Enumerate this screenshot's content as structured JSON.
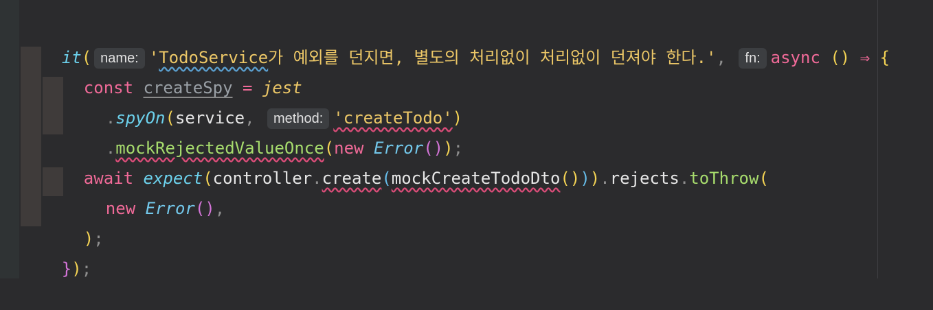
{
  "editor": {
    "language": "typescript",
    "line1": {
      "it": "it",
      "open_paren": "(",
      "hint_name": "name:",
      "quote_open": "'",
      "todoservice": "TodoService",
      "korean": "가 예외를 던지면, 별도의 처리없이 처리없이 던져야 한다.",
      "quote_close": "'",
      "comma": ",",
      "hint_fn": "fn:",
      "async": "async",
      "params": "()",
      "arrow": "⇒",
      "brace": "{"
    },
    "line2": {
      "const": "const",
      "var": "createSpy",
      "eq": "=",
      "jest": "jest"
    },
    "line3": {
      "dot": ".",
      "method": "spyOn",
      "open": "(",
      "arg": "service",
      "comma": ",",
      "hint_method": "method:",
      "str": "'createTodo'",
      "close": ")"
    },
    "line4": {
      "dot": ".",
      "method": "mockRejectedValueOnce",
      "open": "(",
      "new": "new",
      "cls": "Error",
      "parens": "()",
      "close": ")",
      "semi": ";"
    },
    "line5": {
      "await": "await",
      "expect": "expect",
      "open": "(",
      "controller": "controller",
      "dot1": ".",
      "create": "create",
      "open2": "(",
      "dto": "mockCreateTodoDto",
      "parens": "()",
      "close2": ")",
      "close1": ")",
      "dot2": ".",
      "rejects": "rejects",
      "dot3": ".",
      "tothrow": "toThrow",
      "open3": "("
    },
    "line6": {
      "new": "new",
      "cls": "Error",
      "parens": "()",
      "comma": ","
    },
    "line7": {
      "close": ")",
      "semi": ";"
    },
    "line8": {
      "brace": "}",
      "paren": ")",
      "semi": ";"
    }
  }
}
